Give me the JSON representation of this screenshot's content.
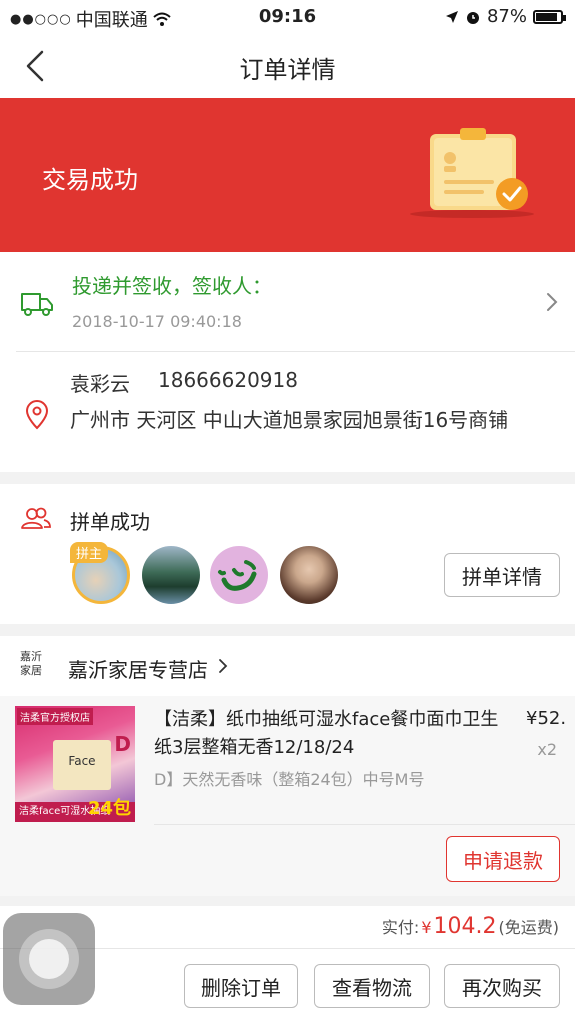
{
  "status_bar": {
    "signal": "●●○○○",
    "carrier": "中国联通",
    "time": "09:16",
    "battery": "87%"
  },
  "nav": {
    "title": "订单详情"
  },
  "banner": {
    "status": "交易成功",
    "bg_color": "#e03530"
  },
  "delivery": {
    "message": "投递并签收，签收人：",
    "timestamp": "2018-10-17 09:40:18"
  },
  "address": {
    "name": "袁彩云",
    "phone": "18666620918",
    "detail": "广州市 天河区 中山大道旭景家园旭景街16号商铺"
  },
  "group_buy": {
    "title": "拼单成功",
    "leader_tag": "拼主",
    "detail_button": "拼单详情"
  },
  "store": {
    "logo_text": "嘉沂家居",
    "name": "嘉沂家居专营店"
  },
  "product": {
    "title": "【洁柔】纸巾抽纸可湿水face餐巾面巾卫生纸3层整箱无香12/18/24",
    "spec": "D】天然无香味（整箱24包）中号M号",
    "price": "¥52.",
    "quantity": "x2",
    "thumb_tag": "洁柔官方授权店",
    "thumb_pack": "Face",
    "thumb_letter": "D",
    "thumb_bar": "洁柔face可湿水抽纸",
    "thumb_badge": "24包",
    "refund_button": "申请退款"
  },
  "summary": {
    "paid_label": "实付:",
    "currency": "¥",
    "amount": "104.2",
    "shipping_note": "(免运费)",
    "accent_color": "#e03530"
  },
  "actions": {
    "delete": "删除订单",
    "track": "查看物流",
    "rebuy": "再次购买"
  }
}
